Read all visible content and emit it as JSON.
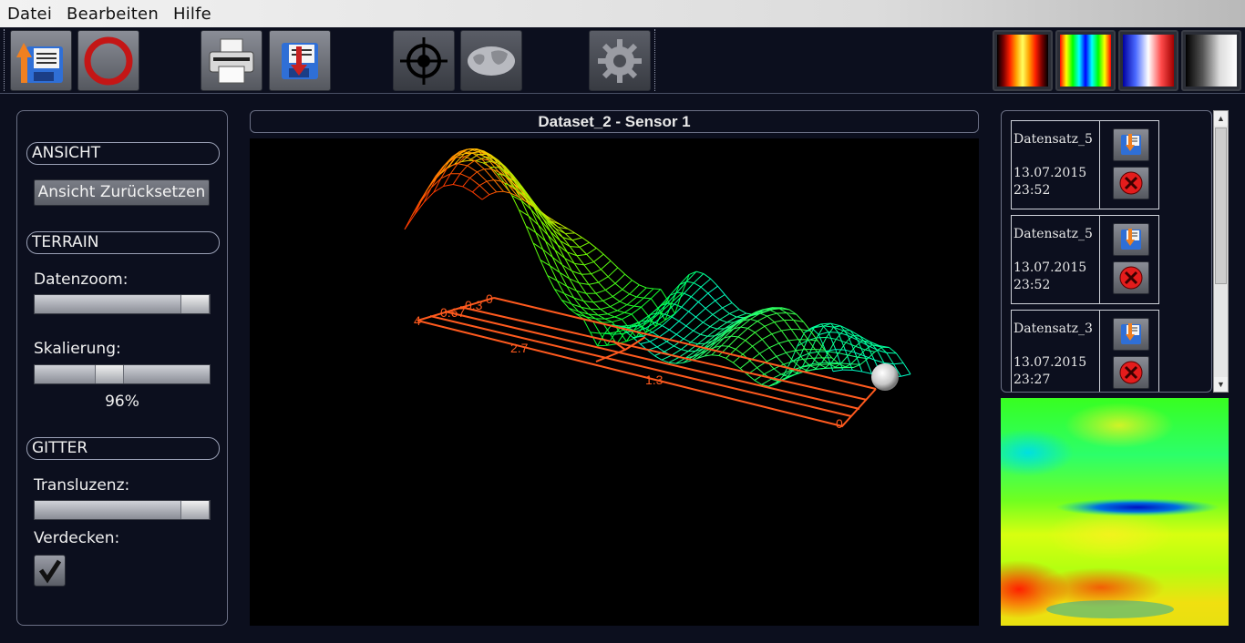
{
  "menubar": {
    "items": [
      "Datei",
      "Bearbeiten",
      "Hilfe"
    ]
  },
  "toolbar": {
    "buttons": [
      "save-export",
      "cancel",
      "print",
      "import",
      "target",
      "world-map",
      "settings"
    ],
    "palettes": [
      "heat",
      "rainbow",
      "blue-white-red",
      "grayscale"
    ]
  },
  "left": {
    "ansicht_head": "ANSICHT",
    "reset_label": "Ansicht Zurücksetzen",
    "terrain_head": "TERRAIN",
    "datenzoom_label": "Datenzoom:",
    "datenzoom_level": 1.0,
    "skalierung_label": "Skalierung:",
    "skalierung_value": "96%",
    "gitter_head": "GITTER",
    "transluzenz_label": "Transluzenz:",
    "transluzenz_level": 1.0,
    "verdecken_label": "Verdecken:",
    "verdecken_checked": true
  },
  "view": {
    "title": "Dataset_2 - Sensor 1",
    "axis_labels": [
      "4",
      "0.67",
      "0.3",
      "0",
      "2.7",
      "1.3",
      "0"
    ]
  },
  "datasets": [
    {
      "name": "Datensatz_5",
      "date": "13.07.2015",
      "time": "23:52"
    },
    {
      "name": "Datensatz_5",
      "date": "13.07.2015",
      "time": "23:52"
    },
    {
      "name": "Datensatz_3",
      "date": "13.07.2015",
      "time": "23:27"
    }
  ],
  "colors": {
    "accent": "#ff5a1e",
    "panel_border": "#6b7085",
    "background": "#0c0f1e"
  }
}
